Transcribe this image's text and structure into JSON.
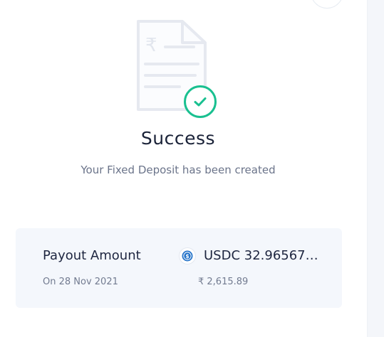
{
  "success": {
    "title": "Success",
    "message": "Your Fixed Deposit has been created",
    "illustration_icon": "rupee-document-icon",
    "badge_icon": "check-circle-icon",
    "accent_color": "#19c090"
  },
  "payout": {
    "label": "Payout Amount",
    "date": "On 28 Nov 2021",
    "coin_icon": "usdc-coin-icon",
    "amount": "USDC 32.96567…",
    "fiat_value": "₹ 2,615.89"
  }
}
